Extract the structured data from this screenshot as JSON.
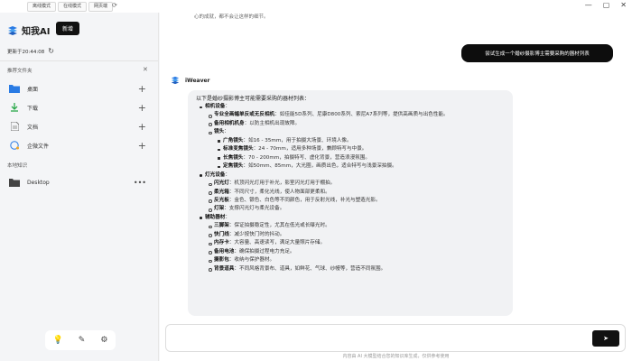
{
  "titlebar": {
    "modes": [
      "离线模式",
      "在线模式",
      "网页端"
    ],
    "window_buttons": [
      "—",
      "▢",
      "✕"
    ]
  },
  "sidebar": {
    "app_name": "知我AI",
    "new_button": "新增",
    "updated": "更新于20:44:08",
    "recommended_title": "推荐文件夹",
    "folders": [
      {
        "label": "桌面",
        "icon": "folder-icon"
      },
      {
        "label": "下载",
        "icon": "download-icon"
      },
      {
        "label": "文档",
        "icon": "document-icon"
      },
      {
        "label": "企微文件",
        "icon": "chat-file-icon"
      }
    ],
    "local_title": "本地知识",
    "local_items": [
      {
        "label": "Desktop",
        "icon": "folder-icon"
      }
    ]
  },
  "chat": {
    "previous_text": "心的成就，都不会让这样的细节。",
    "user_message": "尝试生成一个婚纱摄影博主需要采购的器材列表",
    "bot_name": "iWeaver",
    "intro": "以下是婚纱摄影博主可能需要采购的器材列表：",
    "lines": [
      {
        "level": 1,
        "bold": "相机设备",
        "text": "："
      },
      {
        "level": 2,
        "bold": "专业全画幅单反或无反相机",
        "text": "：如佳能5D系列、尼康D800系列、索尼A7系列等，提供高画质与出色性能。"
      },
      {
        "level": 2,
        "bold": "备用相机机身",
        "text": "：以防主相机出现故障。"
      },
      {
        "level": 2,
        "bold": "镜头",
        "text": "："
      },
      {
        "level": 3,
        "bold": "广角镜头",
        "text": "：如16 - 35mm，用于拍摄大场景、环境人像。"
      },
      {
        "level": 3,
        "bold": "标准变焦镜头",
        "text": "：24 - 70mm，适用多种场景，兼顾特写与中景。"
      },
      {
        "level": 3,
        "bold": "长焦镜头",
        "text": "：70 - 200mm，拍摄特写、虚化背景，营造浪漫氛围。"
      },
      {
        "level": 3,
        "bold": "定焦镜头",
        "text": "：如50mm、85mm，大光圈，画质出色，适合特写与浅景深拍摄。"
      },
      {
        "level": 1,
        "bold": "灯光设备",
        "text": "："
      },
      {
        "level": 2,
        "bold": "闪光灯",
        "text": "：机顶闪光灯用于补光，影室闪光灯用于棚拍。"
      },
      {
        "level": 2,
        "bold": "柔光箱",
        "text": "：不同尺寸，柔化光线，使人物面部更柔和。"
      },
      {
        "level": 2,
        "bold": "反光板",
        "text": "：金色、银色、白色等不同颜色，用于反射光线，补光与塑造光影。"
      },
      {
        "level": 2,
        "bold": "灯架",
        "text": "：支撑闪光灯与柔光设备。"
      },
      {
        "level": 1,
        "bold": "辅助器材",
        "text": "："
      },
      {
        "level": 2,
        "bold": "三脚架",
        "text": "：保证拍摄稳定性，尤其在低光或长曝光时。"
      },
      {
        "level": 2,
        "bold": "快门线",
        "text": "：减少按快门时的抖动。"
      },
      {
        "level": 2,
        "bold": "内存卡",
        "text": "：大容量、高速读写，满足大量照片存储。"
      },
      {
        "level": 2,
        "bold": "备用电池",
        "text": "：确保拍摄过程电力充足。"
      },
      {
        "level": 2,
        "bold": "摄影包",
        "text": "：收纳与保护器材。"
      },
      {
        "level": 2,
        "bold": "背景道具",
        "text": "：不同风格背景布、道具，如鲜花、气球、纱幔等，营造不同氛围。"
      }
    ],
    "input_placeholder": "",
    "send_label": "发送",
    "footer_note": "内容由 AI 大模型结合您的知识库生成，仅供参考使用"
  },
  "colors": {
    "brand_blue": "#2a7be4",
    "dark_button": "#111111",
    "sidebar_bg": "#f4f5f7"
  }
}
